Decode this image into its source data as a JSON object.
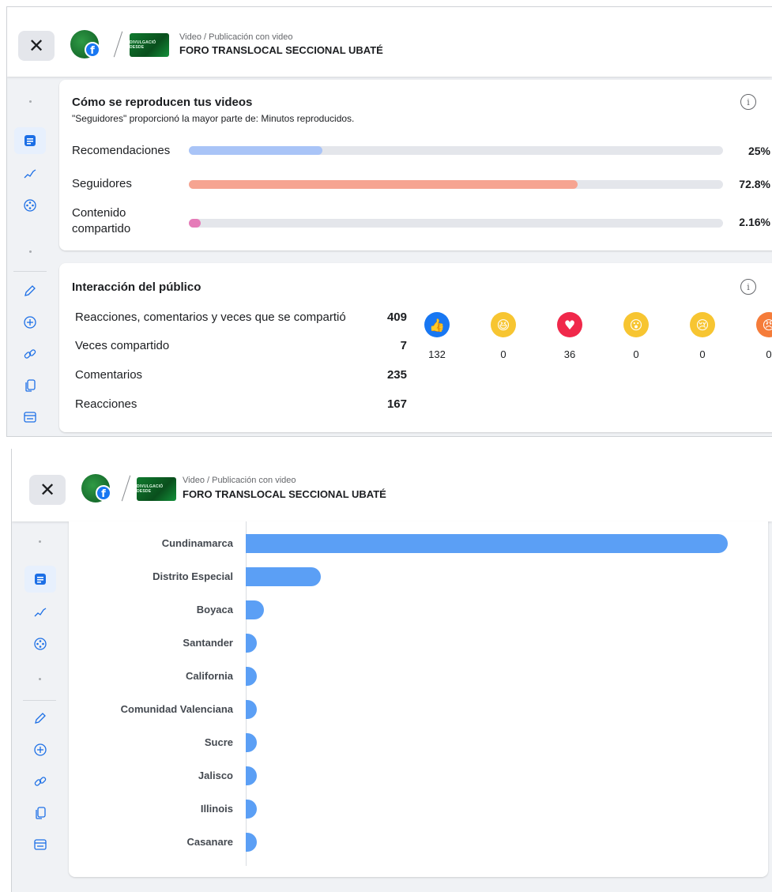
{
  "header": {
    "close_symbol": "✕",
    "fb_badge": "f",
    "thumb_text": "DIVULGACIÓ DESDE",
    "breadcrumb": "Video / Publicación con video",
    "title": "FORO TRANSLOCAL SECCIONAL UBATÉ"
  },
  "sidebar": {
    "icons": [
      "dot",
      "post-details-icon",
      "trend-icon",
      "film-reel-icon",
      "dot",
      "pencil-icon",
      "plus-circle-icon",
      "link-icon",
      "copy-icon",
      "card-icon"
    ],
    "active": "post-details-icon"
  },
  "playback": {
    "title": "Cómo se reproducen tus videos",
    "subtitle": "\"Seguidores\" proporcionó la mayor parte de: Minutos reproducidos.",
    "info_symbol": "i",
    "sources": [
      {
        "label": "Recomendaciones",
        "percent_text": "25%",
        "value": 25,
        "color": "#a9c4f7"
      },
      {
        "label": "Seguidores",
        "percent_text": "72.8%",
        "value": 72.8,
        "color": "#f6a491"
      },
      {
        "label": "Contenido compartido",
        "percent_text": "2.16%",
        "value": 2.16,
        "color": "#e57bb8"
      }
    ]
  },
  "engagement": {
    "title": "Interacción del público",
    "info_symbol": "i",
    "rows": [
      {
        "label": "Reacciones, comentarios y veces que se compartió",
        "value": "409"
      },
      {
        "label": "Veces compartido",
        "value": "7"
      },
      {
        "label": "Comentarios",
        "value": "235"
      },
      {
        "label": "Reacciones",
        "value": "167"
      }
    ],
    "reactions": [
      {
        "icon": "like-icon",
        "glyph": "👍",
        "color": "#1877f2",
        "count": "132"
      },
      {
        "icon": "haha-icon",
        "glyph": "😆",
        "color": "#f7c531",
        "count": "0"
      },
      {
        "icon": "love-icon",
        "glyph": "♥",
        "color": "#f0284a",
        "count": "36"
      },
      {
        "icon": "wow-icon",
        "glyph": "😮",
        "color": "#f7c531",
        "count": "0"
      },
      {
        "icon": "sad-icon",
        "glyph": "😢",
        "color": "#f7c531",
        "count": "0"
      },
      {
        "icon": "angry-icon",
        "glyph": "😠",
        "color": "#f57c3a",
        "count": "0"
      }
    ]
  },
  "chart_data": {
    "type": "bar",
    "orientation": "horizontal",
    "categories": [
      "Cundinamarca",
      "Distrito Especial",
      "Boyaca",
      "Santander",
      "California",
      "Comunidad Valenciana",
      "Sucre",
      "Jalisco",
      "Illinois",
      "Casanare"
    ],
    "values": [
      100,
      15.5,
      3.7,
      1.8,
      1.8,
      1.8,
      1.8,
      1.8,
      1.8,
      1.8
    ],
    "values_unit": "relative share (Cundinamarca = 100), estimated from bar lengths",
    "color": "#5b9ff5",
    "xlabel": "",
    "ylabel": "",
    "title": ""
  }
}
